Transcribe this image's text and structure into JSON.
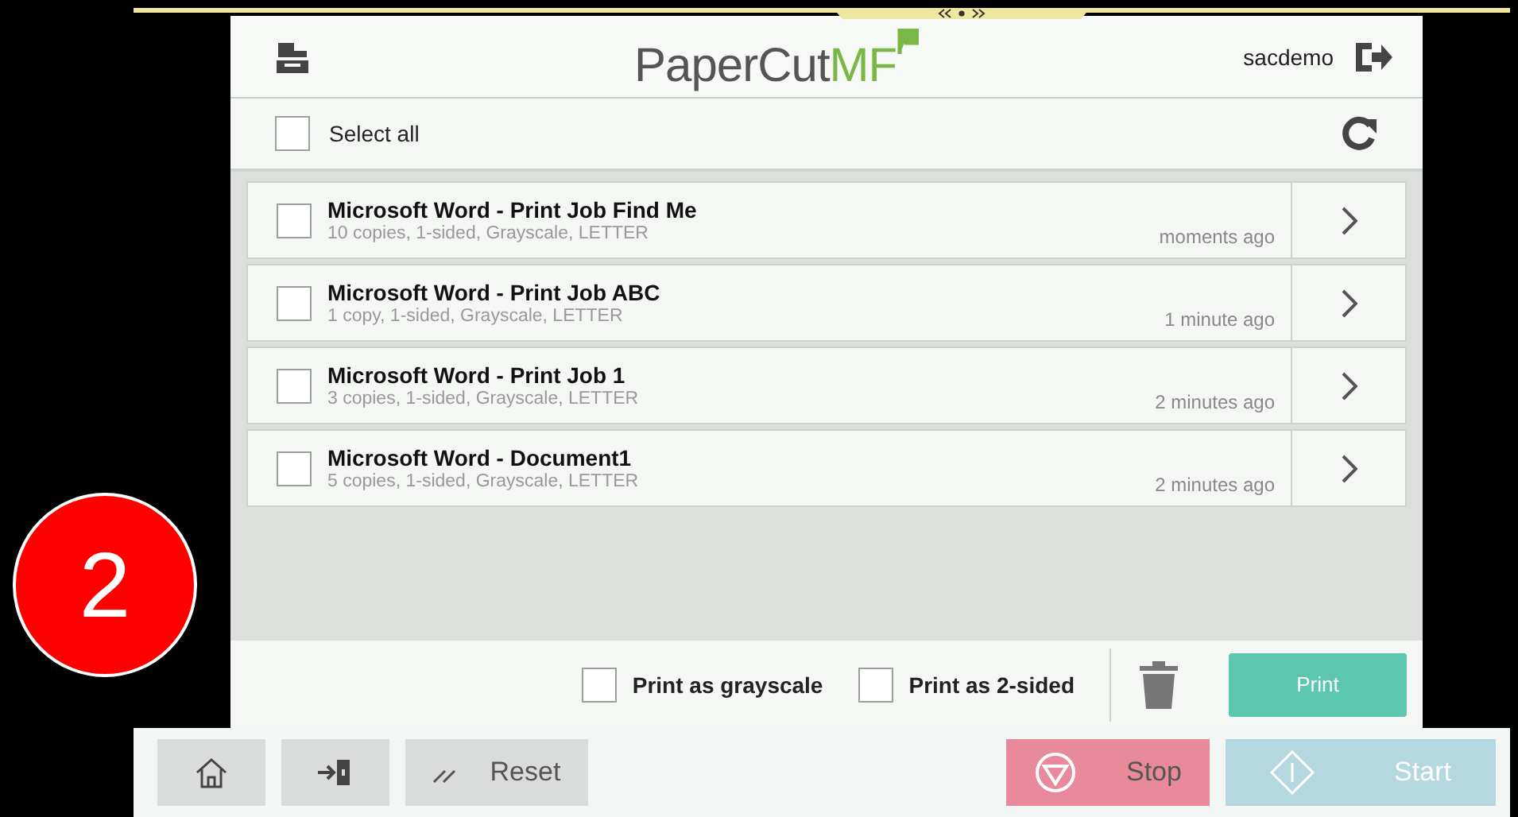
{
  "header": {
    "logo_main": "PaperCut",
    "logo_accent": "MF",
    "user": "sacdemo"
  },
  "select_all": {
    "label": "Select all",
    "checked": false
  },
  "jobs": [
    {
      "title": "Microsoft Word - Print Job Find Me",
      "details": "10 copies, 1-sided, Grayscale, LETTER",
      "time": "moments ago",
      "checked": false
    },
    {
      "title": "Microsoft Word - Print Job ABC",
      "details": "1 copy, 1-sided, Grayscale, LETTER",
      "time": "1 minute ago",
      "checked": false
    },
    {
      "title": "Microsoft Word - Print Job 1",
      "details": "3 copies, 1-sided, Grayscale, LETTER",
      "time": "2 minutes ago",
      "checked": false
    },
    {
      "title": "Microsoft Word - Document1",
      "details": "5 copies, 1-sided, Grayscale, LETTER",
      "time": "2 minutes ago",
      "checked": false
    }
  ],
  "options": [
    {
      "label": "Print as grayscale",
      "checked": false
    },
    {
      "label": "Print as 2-sided",
      "checked": false
    }
  ],
  "print_button": "Print",
  "device_bar": {
    "reset": "Reset",
    "stop": "Stop",
    "start": "Start"
  },
  "step_badge": "2"
}
